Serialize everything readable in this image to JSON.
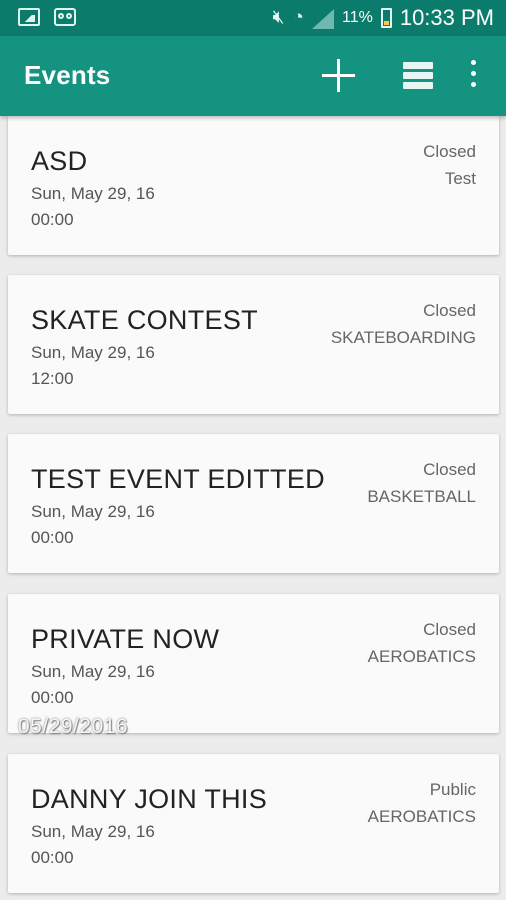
{
  "status_bar": {
    "battery": "11%",
    "time": "10:33 PM",
    "icons": [
      "gallery-icon",
      "voicemail-icon",
      "mute-icon",
      "wifi-icon",
      "signal-icon",
      "battery-icon"
    ]
  },
  "appbar": {
    "title": "Events",
    "actions": [
      "add-icon",
      "list-view-icon",
      "overflow-menu-icon"
    ]
  },
  "events": [
    {
      "name": "ASD",
      "date": "Sun, May 29, 16",
      "time": "00:00",
      "status": "Closed",
      "category": "Test"
    },
    {
      "name": "SKATE CONTEST",
      "date": "Sun, May 29, 16",
      "time": "12:00",
      "status": "Closed",
      "category": "SKATEBOARDING"
    },
    {
      "name": "TEST EVENT EDITTED",
      "date": "Sun, May 29, 16",
      "time": "00:00",
      "status": "Closed",
      "category": "BASKETBALL"
    },
    {
      "name": "PRIVATE NOW",
      "date": "Sun, May 29, 16",
      "time": "00:00",
      "status": "Closed",
      "category": "AEROBATICS"
    },
    {
      "name": "DANNY JOIN THIS",
      "date": "Sun, May 29, 16",
      "time": "00:00",
      "status": "Public",
      "category": "AEROBATICS"
    }
  ],
  "watermark": "05/29/2016",
  "colors": {
    "status_bar": "#0b7c6c",
    "appbar": "#149480",
    "background": "#ececec",
    "card": "#fafafa"
  }
}
